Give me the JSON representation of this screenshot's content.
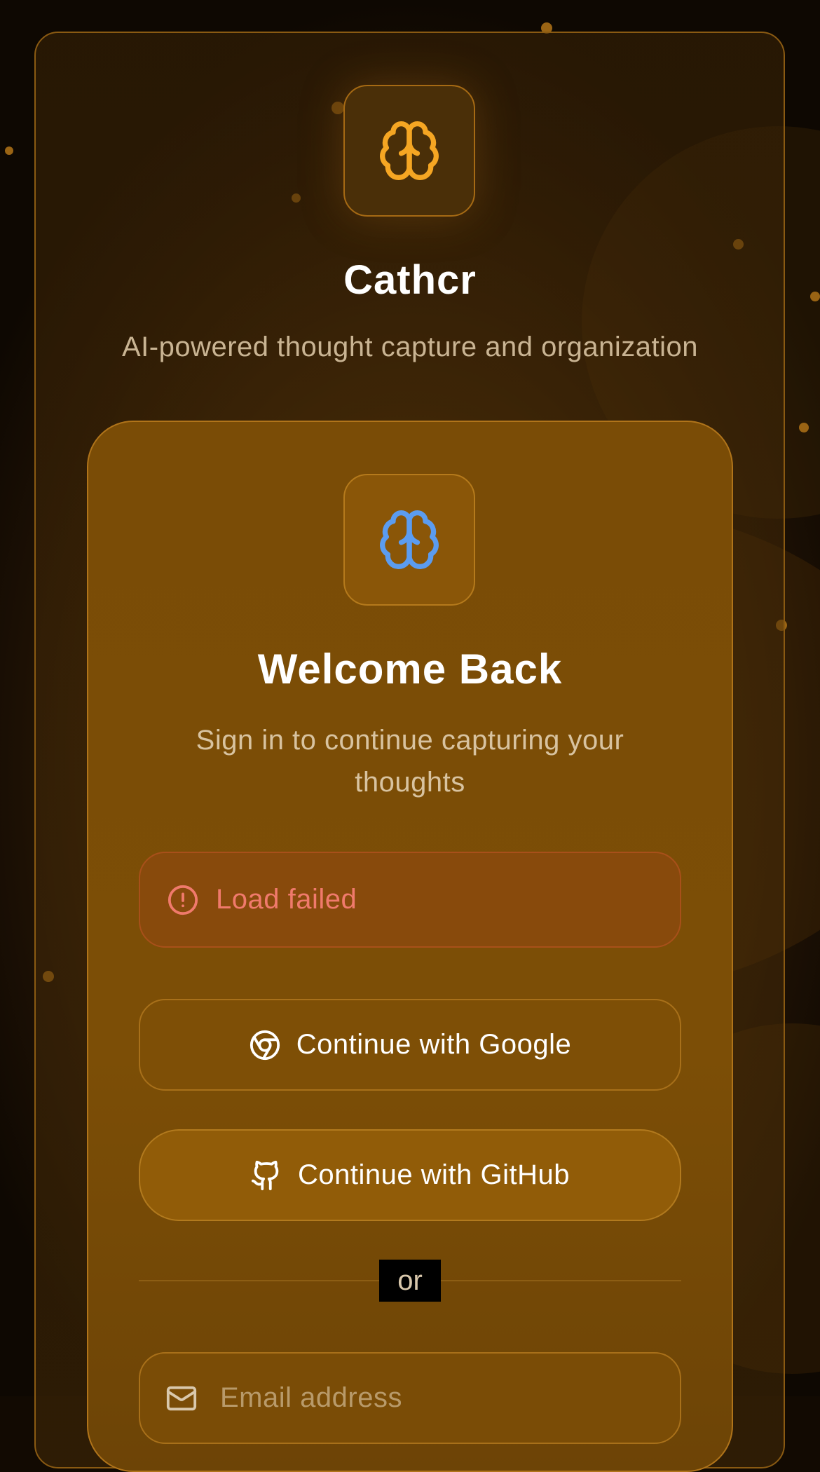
{
  "app": {
    "title": "Cathcr",
    "subtitle": "AI-powered thought capture and organization"
  },
  "auth_card": {
    "heading": "Welcome Back",
    "subheading": "Sign in to continue capturing your thoughts",
    "error_message": "Load failed",
    "google_button_label": "Continue with Google",
    "github_button_label": "Continue with GitHub",
    "divider_text": "or",
    "email_placeholder": "Email address",
    "email_value": ""
  },
  "icons": {
    "logo": "brain-icon",
    "card_logo": "brain-icon",
    "error": "alert-circle-icon",
    "google": "chrome-icon",
    "github": "github-icon",
    "email": "mail-icon"
  },
  "colors": {
    "accent": "#f5a623",
    "card_logo": "#5b9cf0",
    "error": "#f07a6c",
    "background": "#120a02"
  }
}
